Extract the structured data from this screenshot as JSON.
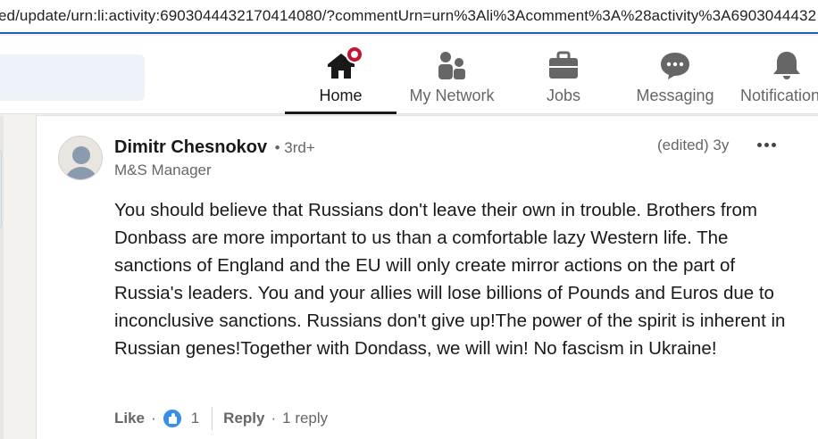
{
  "browser": {
    "url": "ed/update/urn:li:activity:6903044432170414080/?commentUrn=urn%3Ali%3Acomment%3A%28activity%3A6903044432"
  },
  "nav": {
    "items": [
      {
        "label": "Home",
        "icon": "home-icon",
        "active": true
      },
      {
        "label": "My Network",
        "icon": "my-network-icon"
      },
      {
        "label": "Jobs",
        "icon": "briefcase-icon"
      },
      {
        "label": "Messaging",
        "icon": "messaging-icon"
      },
      {
        "label": "Notifications",
        "icon": "bell-icon"
      }
    ]
  },
  "comment": {
    "author": "Dimitr Chesnokov",
    "degree": "• 3rd+",
    "headline": "M&S Manager",
    "meta": "(edited) 3y",
    "text": "You should believe that Russians don't leave their own in trouble. Brothers from Donbass are more important to us than a comfortable lazy Western life. The sanctions of England and the EU will only create mirror actions on the part of Russia's leaders. You and your allies will lose billions of Pounds and Euros due to inconclusive sanctions. Russians don't give up!The power of the spirit is inherent in Russian genes!Together with Dondass, we will win! No fascism in Ukraine!",
    "actions": {
      "like_label": "Like",
      "like_separator": "·",
      "like_count": "1",
      "reply_label": "Reply",
      "reply_separator": "·",
      "reply_count": "1 reply"
    }
  },
  "colors": {
    "accent": "#0a66c2",
    "like_blue": "#378fe9",
    "notification_red": "#cb112d",
    "text_primary": "#191919",
    "text_secondary": "#666666"
  }
}
